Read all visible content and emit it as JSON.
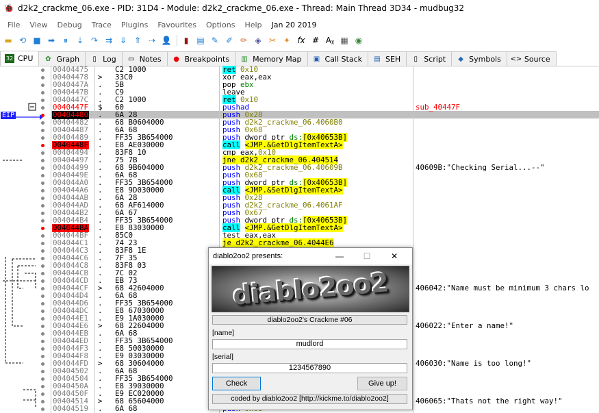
{
  "window": {
    "title": "d2k2_crackme_06.exe - PID: 31D4 - Module: d2k2_crackme_06.exe - Thread: Main Thread 3D34 - mudbug32"
  },
  "menu": [
    "File",
    "View",
    "Debug",
    "Trace",
    "Plugins",
    "Favourites",
    "Options",
    "Help"
  ],
  "menu_date": "Jan 20 2019",
  "tabs": [
    {
      "label": "CPU",
      "icon": "cpu-icon"
    },
    {
      "label": "Graph",
      "icon": "graph-icon"
    },
    {
      "label": "Log",
      "icon": "log-icon"
    },
    {
      "label": "Notes",
      "icon": "notes-icon"
    },
    {
      "label": "Breakpoints",
      "icon": "breakpoint-icon"
    },
    {
      "label": "Memory Map",
      "icon": "memory-map-icon"
    },
    {
      "label": "Call Stack",
      "icon": "call-stack-icon"
    },
    {
      "label": "SEH",
      "icon": "seh-icon"
    },
    {
      "label": "Script",
      "icon": "script-icon"
    },
    {
      "label": "Symbols",
      "icon": "symbols-icon"
    },
    {
      "label": "Source",
      "icon": "source-icon"
    }
  ],
  "eip_label": "EIP",
  "rows": [
    {
      "addr": "00404475",
      "mark": " ",
      "bytes": "C2 1000",
      "dis": [
        [
          "ret",
          "k-ret"
        ],
        [
          " 0x10",
          "k-num"
        ]
      ],
      "cmt": ""
    },
    {
      "addr": "00404478",
      "mark": ">",
      "bytes": "33C0",
      "dis": [
        [
          "xor eax,eax",
          ""
        ]
      ],
      "cmt": ""
    },
    {
      "addr": "0040447A",
      "mark": ".",
      "bytes": "5B",
      "dis": [
        [
          "pop ",
          ""
        ],
        [
          "ebx",
          "k-reg"
        ]
      ],
      "cmt": ""
    },
    {
      "addr": "0040447B",
      "mark": ".",
      "bytes": "C9",
      "dis": [
        [
          "leave",
          ""
        ]
      ],
      "cmt": ""
    },
    {
      "addr": "0040447C",
      "mark": ".",
      "bytes": "C2 1000",
      "dis": [
        [
          "ret",
          "k-ret"
        ],
        [
          " 0x10",
          "k-num"
        ]
      ],
      "cmt": ""
    },
    {
      "addr": "0040447F",
      "mark": "$",
      "bytes": "60",
      "dis": [
        [
          "pushad",
          "k-push"
        ]
      ],
      "cmt": "sub_40447F",
      "addrcls": "ep",
      "cmtcolor": "#ff0000"
    },
    {
      "addr": "00404480",
      "mark": ".",
      "bytes": "6A 28",
      "dis": [
        [
          "push ",
          "k-push"
        ],
        [
          "0x28",
          "k-num"
        ]
      ],
      "cmt": "",
      "addrcls": "hl"
    },
    {
      "addr": "00404482",
      "mark": ".",
      "bytes": "68 B0604000",
      "dis": [
        [
          "push ",
          "k-push"
        ],
        [
          "d2k2_crackme_06.4060B0",
          "k-num"
        ]
      ],
      "cmt": ""
    },
    {
      "addr": "00404487",
      "mark": ".",
      "bytes": "6A 68",
      "dis": [
        [
          "push ",
          "k-push"
        ],
        [
          "0x68",
          "k-num"
        ]
      ],
      "cmt": ""
    },
    {
      "addr": "00404489",
      "mark": ".",
      "bytes": "FF35 3B654000",
      "dis": [
        [
          "push ",
          "k-push"
        ],
        [
          "dword ptr ",
          ""
        ],
        [
          "ds:",
          "k-reg"
        ],
        [
          "[0x40653B]",
          "k-jmp"
        ]
      ],
      "cmt": ""
    },
    {
      "addr": "0040448F",
      "mark": ".",
      "bytes": "E8 AE030000",
      "dis": [
        [
          "call",
          "k-call"
        ],
        [
          " ",
          ""
        ],
        [
          "<JMP.&GetDlgItemTextA>",
          "k-jmp"
        ]
      ],
      "cmt": "",
      "addrcls": "bp"
    },
    {
      "addr": "00404494",
      "mark": ".",
      "bytes": "83F8 10",
      "dis": [
        [
          "cmp eax,",
          ""
        ],
        [
          "0x10",
          "k-num"
        ]
      ],
      "cmt": ""
    },
    {
      "addr": "00404497",
      "mark": ".",
      "bytes": "75 7B",
      "dis": [
        [
          "jne",
          "k-jmp"
        ],
        [
          " d2k2_crackme_06.404514",
          "k-jmp"
        ]
      ],
      "cmt": ""
    },
    {
      "addr": "00404499",
      "mark": ".",
      "bytes": "68 9B604000",
      "dis": [
        [
          "push ",
          "k-push"
        ],
        [
          "d2k2_crackme_06.40609B",
          "k-num"
        ]
      ],
      "cmt": "40609B:\"Checking Serial...--\""
    },
    {
      "addr": "0040449E",
      "mark": ".",
      "bytes": "6A 68",
      "dis": [
        [
          "push ",
          "k-push"
        ],
        [
          "0x68",
          "k-num"
        ]
      ],
      "cmt": ""
    },
    {
      "addr": "004044A0",
      "mark": ".",
      "bytes": "FF35 3B654000",
      "dis": [
        [
          "push ",
          "k-push"
        ],
        [
          "dword ptr ",
          ""
        ],
        [
          "ds:",
          "k-reg"
        ],
        [
          "[0x40653B]",
          "k-jmp"
        ]
      ],
      "cmt": ""
    },
    {
      "addr": "004044A6",
      "mark": ".",
      "bytes": "E8 9D030000",
      "dis": [
        [
          "call",
          "k-call"
        ],
        [
          " ",
          ""
        ],
        [
          "<JMP.&SetDlgItemTextA>",
          "k-jmp"
        ]
      ],
      "cmt": ""
    },
    {
      "addr": "004044AB",
      "mark": ".",
      "bytes": "6A 28",
      "dis": [
        [
          "push ",
          "k-push"
        ],
        [
          "0x28",
          "k-num"
        ]
      ],
      "cmt": ""
    },
    {
      "addr": "004044AD",
      "mark": ".",
      "bytes": "68 AF614000",
      "dis": [
        [
          "push ",
          "k-push"
        ],
        [
          "d2k2_crackme_06.4061AF",
          "k-num"
        ]
      ],
      "cmt": ""
    },
    {
      "addr": "004044B2",
      "mark": ".",
      "bytes": "6A 67",
      "dis": [
        [
          "push ",
          "k-push"
        ],
        [
          "0x67",
          "k-num"
        ]
      ],
      "cmt": ""
    },
    {
      "addr": "004044B4",
      "mark": ".",
      "bytes": "FF35 3B654000",
      "dis": [
        [
          "push ",
          "k-push"
        ],
        [
          "dword ptr ",
          ""
        ],
        [
          "ds:",
          "k-reg"
        ],
        [
          "[0x40653B]",
          "k-jmp"
        ]
      ],
      "cmt": ""
    },
    {
      "addr": "004044BA",
      "mark": ".",
      "bytes": "E8 83030000",
      "dis": [
        [
          "call",
          "k-call"
        ],
        [
          " ",
          ""
        ],
        [
          "<JMP.&GetDlgItemTextA>",
          "k-jmp"
        ]
      ],
      "cmt": "",
      "addrcls": "bp"
    },
    {
      "addr": "004044BF",
      "mark": ".",
      "bytes": "85C0",
      "dis": [
        [
          "test eax,eax",
          ""
        ]
      ],
      "cmt": ""
    },
    {
      "addr": "004044C1",
      "mark": ".",
      "bytes": "74 23",
      "dis": [
        [
          "je d2k2_crackme_06.4044E6",
          "k-jmp"
        ]
      ],
      "cmt": ""
    },
    {
      "addr": "004044C3",
      "mark": ".",
      "bytes": "83F8 1E",
      "dis": [
        [
          "",
          ""
        ]
      ],
      "cmt": ""
    },
    {
      "addr": "004044C6",
      "mark": ".",
      "bytes": "7F 35",
      "dis": [
        [
          "",
          ""
        ]
      ],
      "cmt": ""
    },
    {
      "addr": "004044C8",
      "mark": ".",
      "bytes": "83F8 03",
      "dis": [
        [
          "",
          ""
        ]
      ],
      "cmt": ""
    },
    {
      "addr": "004044CB",
      "mark": ".",
      "bytes": "7C 02",
      "dis": [
        [
          "",
          ""
        ]
      ],
      "cmt": ""
    },
    {
      "addr": "004044CD",
      "mark": ".",
      "bytes": "EB 73",
      "dis": [
        [
          "",
          ""
        ]
      ],
      "cmt": ""
    },
    {
      "addr": "004044CF",
      "mark": ">",
      "bytes": "68 42604000",
      "dis": [
        [
          "",
          ""
        ]
      ],
      "cmt": "406042:\"Name must be minimum 3 chars lo"
    },
    {
      "addr": "004044D4",
      "mark": ".",
      "bytes": "6A 68",
      "dis": [
        [
          "",
          ""
        ]
      ],
      "cmt": ""
    },
    {
      "addr": "004044D6",
      "mark": ".",
      "bytes": "FF35 3B654000",
      "dis": [
        [
          "",
          ""
        ]
      ],
      "cmt": ""
    },
    {
      "addr": "004044DC",
      "mark": ".",
      "bytes": "E8 67030000",
      "dis": [
        [
          "",
          ""
        ]
      ],
      "cmt": ""
    },
    {
      "addr": "004044E1",
      "mark": ".",
      "bytes": "E9 1A030000",
      "dis": [
        [
          "",
          ""
        ]
      ],
      "cmt": ""
    },
    {
      "addr": "004044E6",
      "mark": ">",
      "bytes": "68 22604000",
      "dis": [
        [
          "",
          ""
        ]
      ],
      "cmt": "406022:\"Enter a name!\""
    },
    {
      "addr": "004044EB",
      "mark": ".",
      "bytes": "6A 68",
      "dis": [
        [
          "",
          ""
        ]
      ],
      "cmt": ""
    },
    {
      "addr": "004044ED",
      "mark": ".",
      "bytes": "FF35 3B654000",
      "dis": [
        [
          "",
          ""
        ]
      ],
      "cmt": ""
    },
    {
      "addr": "004044F3",
      "mark": ".",
      "bytes": "E8 50030000",
      "dis": [
        [
          "",
          ""
        ]
      ],
      "cmt": ""
    },
    {
      "addr": "004044F8",
      "mark": ".",
      "bytes": "E9 03030000",
      "dis": [
        [
          "",
          ""
        ]
      ],
      "cmt": ""
    },
    {
      "addr": "004044FD",
      "mark": ">",
      "bytes": "68 30604000",
      "dis": [
        [
          "",
          ""
        ]
      ],
      "cmt": "406030:\"Name is too long!\""
    },
    {
      "addr": "00404502",
      "mark": ".",
      "bytes": "6A 68",
      "dis": [
        [
          "",
          ""
        ]
      ],
      "cmt": ""
    },
    {
      "addr": "00404504",
      "mark": ".",
      "bytes": "FF35 3B654000",
      "dis": [
        [
          "",
          ""
        ]
      ],
      "cmt": ""
    },
    {
      "addr": "0040450A",
      "mark": ".",
      "bytes": "E8 39030000",
      "dis": [
        [
          "",
          ""
        ]
      ],
      "cmt": ""
    },
    {
      "addr": "0040450F",
      "mark": ".",
      "bytes": "E9 EC020000",
      "dis": [
        [
          "",
          ""
        ]
      ],
      "cmt": ""
    },
    {
      "addr": "00404514",
      "mark": ">",
      "bytes": "68 65604000",
      "dis": [
        [
          "",
          ""
        ]
      ],
      "cmt": "406065:\"Thats not the right way!\""
    },
    {
      "addr": "00404519",
      "mark": ".",
      "bytes": "6A 68",
      "dis": [
        [
          "push ",
          "k-push"
        ],
        [
          "0x68",
          "k-num"
        ]
      ],
      "cmt": ""
    }
  ],
  "dialog": {
    "title": "diablo2oo2 presents:",
    "logo_text": "diablo2oo2",
    "banner": "diablo2oo2's Crackme #06",
    "name_label": "[name]",
    "name_value": "mudlord",
    "serial_label": "[serial]",
    "serial_value": "1234567890",
    "check_button": "Check",
    "giveup_button": "Give up!",
    "footer": "coded by diablo2oo2 [http://kickme.to/diablo2oo2]",
    "minimize": "—",
    "maximize": "☐",
    "close": "✕"
  }
}
